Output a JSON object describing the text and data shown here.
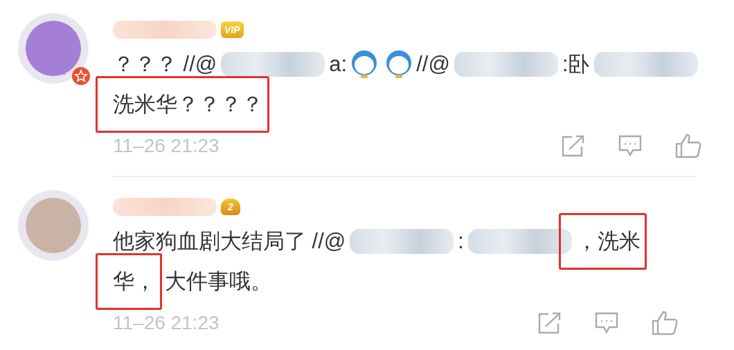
{
  "comments": [
    {
      "avatar": {
        "color": "#a57fd6"
      },
      "badge": {
        "kind": "vip",
        "text": "VIP"
      },
      "lines": [
        [
          {
            "kind": "text",
            "text": "？？？ //@"
          },
          {
            "kind": "blur"
          },
          {
            "kind": "text",
            "text": "a:"
          },
          {
            "kind": "emoji"
          },
          {
            "kind": "emoji"
          },
          {
            "kind": "text",
            "text": "//@"
          },
          {
            "kind": "blur"
          },
          {
            "kind": "text",
            "text": ":卧"
          },
          {
            "kind": "blur"
          }
        ],
        [
          {
            "kind": "highlight",
            "text": "洗米华？？？？"
          }
        ]
      ],
      "time": "11–26 21:23"
    },
    {
      "avatar": {
        "color": "#c9b2a6"
      },
      "badge": {
        "kind": "crown",
        "text": "2"
      },
      "lines": [
        [
          {
            "kind": "text",
            "text": "他家狗血剧大结局了 //@"
          },
          {
            "kind": "blur"
          },
          {
            "kind": "text",
            "text": ":"
          },
          {
            "kind": "blur"
          },
          {
            "kind": "highlight",
            "text": "，洗米"
          }
        ],
        [
          {
            "kind": "highlight",
            "text": "华，"
          },
          {
            "kind": "text",
            "text": "大件事哦。"
          }
        ]
      ],
      "time": "11–26 21:23"
    }
  ]
}
